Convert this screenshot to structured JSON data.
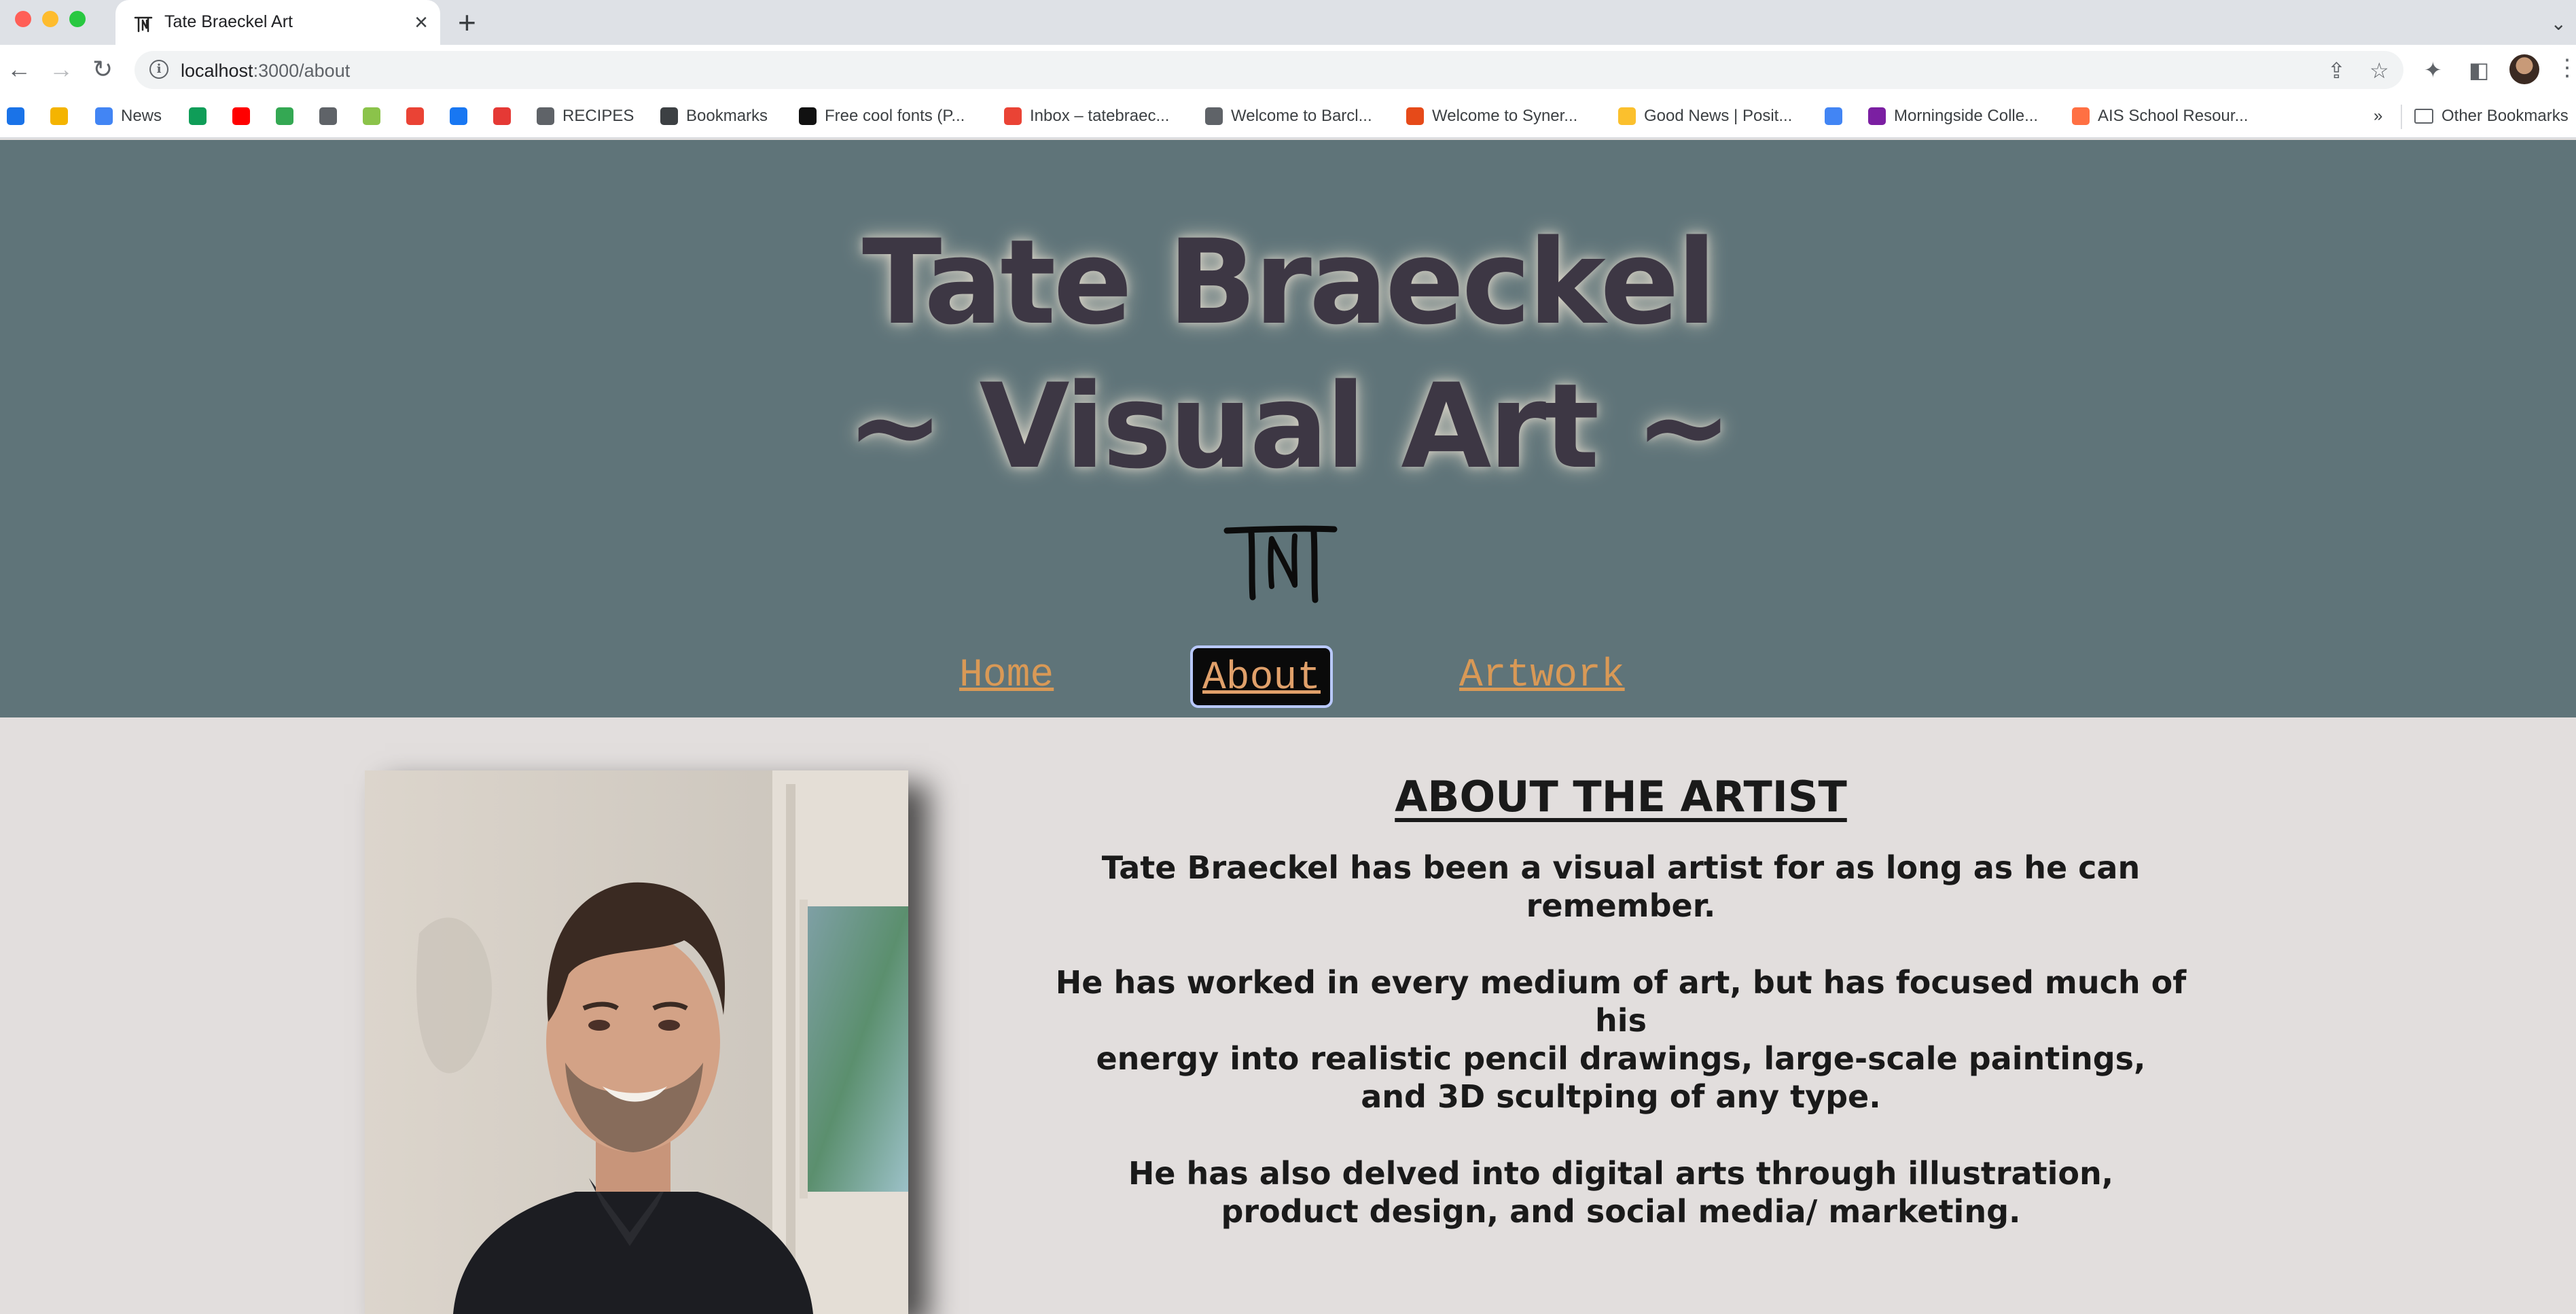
{
  "browser": {
    "tab_title": "Tate Braeckel Art",
    "new_tab": "+",
    "url_host": "localhost",
    "url_path": ":3000/about",
    "bookmarks": [
      {
        "label": "",
        "color": "#1a73e8"
      },
      {
        "label": "",
        "color": "#f4b400"
      },
      {
        "label": "News",
        "color": "#4285f4"
      },
      {
        "label": "",
        "color": "#0f9d58"
      },
      {
        "label": "",
        "color": "#ff0000"
      },
      {
        "label": "",
        "color": "#34a853"
      },
      {
        "label": "",
        "color": "#5f6368"
      },
      {
        "label": "",
        "color": "#8bc34a"
      },
      {
        "label": "",
        "color": "#ea4335"
      },
      {
        "label": "",
        "color": "#1877f2"
      },
      {
        "label": "",
        "color": "#e53935"
      },
      {
        "label": "RECIPES",
        "color": "#5f6368"
      },
      {
        "label": "Bookmarks",
        "color": "#3c4043"
      },
      {
        "label": "Free cool fonts (P...",
        "color": "#111111"
      },
      {
        "label": "Inbox – tatebraec...",
        "color": "#ea4335"
      },
      {
        "label": "Welcome to Barcl...",
        "color": "#5f6368"
      },
      {
        "label": "Welcome to Syner...",
        "color": "#e64a19"
      },
      {
        "label": "Good News | Posit...",
        "color": "#fbc02d"
      },
      {
        "label": "",
        "color": "#4285f4"
      },
      {
        "label": "Morningside Colle...",
        "color": "#7b1fa2"
      },
      {
        "label": "AIS School Resour...",
        "color": "#ff7043"
      }
    ],
    "more_bookmarks": "»",
    "other_bookmarks": "Other Bookmarks"
  },
  "site": {
    "title_line1": "Tate Braeckel",
    "title_line2": "~ Visual Art ~",
    "nav": {
      "home": "Home",
      "about": "About",
      "artwork": "Artwork"
    }
  },
  "about": {
    "heading": "ABOUT THE ARTIST",
    "p1": "Tate Braeckel has been a visual artist for as long as he can remember.",
    "p2_line1": "He has worked in every medium of art, but has focused much of his",
    "p2_line2": "energy into realistic pencil drawings, large-scale paintings,",
    "p2_line3": "and 3D scultping of any type.",
    "p3_line1": "He has also delved into digital arts through illustration,",
    "p3_line2": "product design, and social media/ marketing."
  },
  "colors": {
    "header_bg": "#5f7479",
    "page_bg": "#e2dedd",
    "title_text": "#3d3744",
    "nav_link": "#d99956",
    "nav_active_bg": "#0a0a0a"
  }
}
